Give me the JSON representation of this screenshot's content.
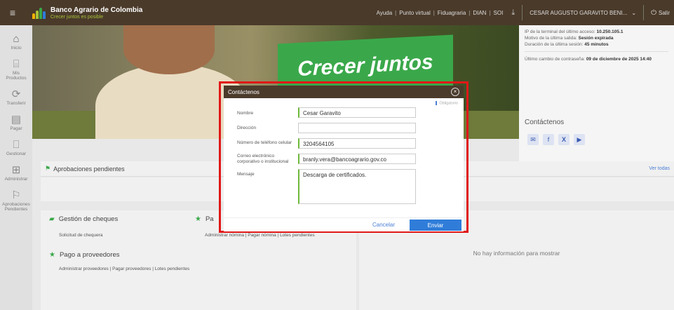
{
  "header": {
    "brand_name": "Banco Agrario de Colombia",
    "brand_tagline": "Crecer juntos es posible",
    "nav_links": [
      "Ayuda",
      "Punto virtual",
      "Fiduagraria",
      "DIAN",
      "SOI"
    ],
    "user_name": "CESAR AUGUSTO GARAVITO BENI...",
    "logout_label": "Salir",
    "colors": {
      "header_bg": "#4a3a2a",
      "brand_green": "#a8c33a"
    }
  },
  "sidebar": {
    "items": [
      {
        "label": "Inicio",
        "icon": "home-icon"
      },
      {
        "label": "Mis Productos",
        "icon": "bank-icon"
      },
      {
        "label": "Transferir",
        "icon": "transfer-icon"
      },
      {
        "label": "Pagar",
        "icon": "pay-icon"
      },
      {
        "label": "Gestionar",
        "icon": "manage-icon"
      },
      {
        "label": "Administrar",
        "icon": "admin-grid-icon"
      },
      {
        "label": "Aprobaciones Pendientes",
        "icon": "flag-icon"
      }
    ]
  },
  "banner": {
    "headline": "Crecer juntos"
  },
  "session_info": {
    "terminal_label": "IP de la terminal del último acceso:",
    "terminal_value": "10.250.105.1",
    "exit_reason_label": "Motivo de la última salida:",
    "exit_reason_value": "Sesión expirada",
    "duration_label": "Duración de la última sesión:",
    "duration_value": "45 minutos",
    "password_change_label": "Último cambio de contraseña:",
    "password_change_value": "09 de diciembre de 2025 14:40",
    "contact_title": "Contáctenos",
    "social_icons": [
      "mail-icon",
      "facebook-icon",
      "x-icon",
      "youtube-icon"
    ]
  },
  "approvals": {
    "title": "Aprobaciones pendientes",
    "view_all": "Ver todas"
  },
  "panels": {
    "checks_title": "Gestión de cheques",
    "checks_links": "Solicitud de chequera",
    "payroll_title": "Pa",
    "payroll_links": "Administrar nómina | Pagar nómina | Lotes pendientes",
    "suppliers_title": "Pago a proveedores",
    "suppliers_links": "Administrar proveedores | Pagar proveedores | Lotes pendientes",
    "empty_message": "No hay información para mostrar"
  },
  "modal": {
    "title": "Contáctenos",
    "required_note": "Obligatorio",
    "fields": {
      "name_label": "Nombre",
      "name_value": "Cesar Garavito",
      "address_label": "Dirección",
      "address_value": "",
      "phone_label": "Número de teléfono celular",
      "phone_value": "3204564105",
      "email_label": "Correo electrónico corporativo o institucional",
      "email_value": "branly.vera@bancoagrario.gov.co",
      "message_label": "Mensaje",
      "message_value": "Descarga de certificados."
    },
    "cancel_label": "Cancelar",
    "send_label": "Enviar",
    "colors": {
      "send_bg": "#2f7dd9",
      "highlight_border": "#e01818",
      "required_accent": "#6fb83b"
    }
  }
}
